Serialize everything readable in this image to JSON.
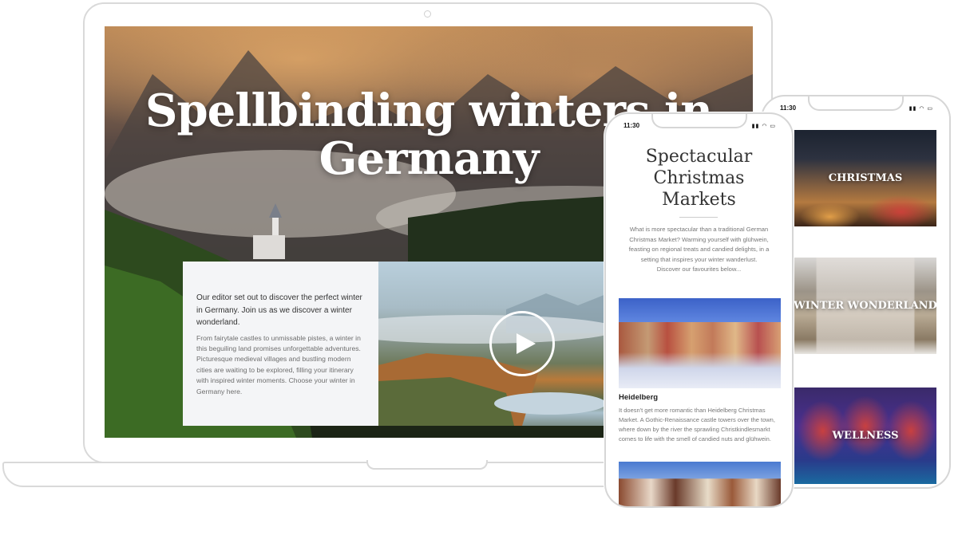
{
  "laptop": {
    "hero_title": "Spellbinding winters in Germany",
    "intro_lead": "Our editor set out to discover the perfect winter in Germany. Join us as we discover a winter wonderland.",
    "intro_body": "From fairytale castles to unmissable pistes, a winter in this beguiling land promises unforgettable adventures. Picturesque medieval villages and bustling modern cities are waiting to be explored, filling your itinerary with inspired winter moments. Choose your winter in Germany here.",
    "play_icon": "play-icon"
  },
  "phone_front": {
    "time": "11:30",
    "title": "Spectacular Christmas Markets",
    "intro": "What is more spectacular than a traditional German Christmas Market? Warming yourself with glühwein, feasting on regional treats and candied delights, in a setting that inspires your winter wanderlust. Discover our favourites below...",
    "item_title": "Heidelberg",
    "item_text": "It doesn't get more romantic than Heidelberg Christmas Market. A Gothic-Renaissance castle towers over the town, where down by the river the sprawling Christkindlesmarkt comes to life with the smell of candied nuts and glühwein."
  },
  "phone_back": {
    "time": "11:30",
    "tiles": [
      "CHRISTMAS",
      "WINTER WONDERLAND",
      "WELLNESS"
    ]
  },
  "colors": {
    "panel_bg": "#f4f5f7",
    "device_outline": "#d9d9d9"
  }
}
